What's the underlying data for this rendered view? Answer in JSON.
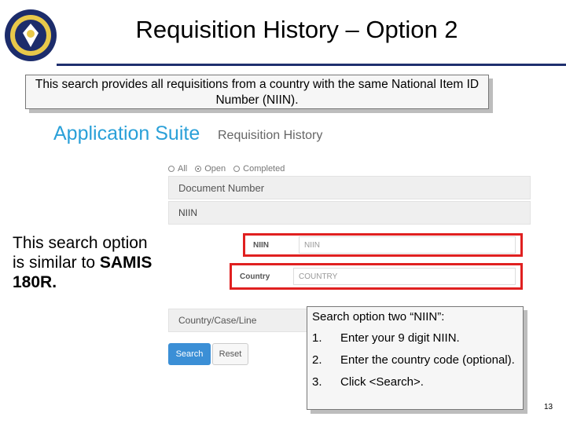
{
  "slide": {
    "title": "Requisition History – Option 2",
    "page_number": "13",
    "logo_icon": "seal-icon"
  },
  "top_callout": {
    "text": "This search provides all requisitions from a country with the same National Item ID Number (NIIN)."
  },
  "app": {
    "title": "Application Suite",
    "subtitle": "Requisition History",
    "accent_color": "#2aa0d8",
    "radios": [
      {
        "label": "All",
        "selected": false
      },
      {
        "label": "Open",
        "selected": true
      },
      {
        "label": "Completed",
        "selected": false
      }
    ],
    "panels": {
      "document_number": "Document Number",
      "niin_header": "NIIN",
      "country_case_line": "Country/Case/Line"
    },
    "fields": {
      "niin_label": "NIIN",
      "niin_placeholder": "NIIN",
      "country_label": "Country",
      "country_placeholder": "COUNTRY"
    },
    "buttons": {
      "search": "Search",
      "reset": "Reset"
    },
    "highlight_color": "#e02020"
  },
  "left_note": {
    "text": "This search option is similar to ",
    "bold": "SAMIS 180R."
  },
  "steps_callout": {
    "heading": "Search option two “NIIN”:",
    "steps": [
      {
        "num": "1.",
        "text": "Enter your 9 digit NIIN."
      },
      {
        "num": "2.",
        "text": "Enter the country code (optional)."
      },
      {
        "num": "3.",
        "text": "Click <Search>."
      }
    ]
  }
}
